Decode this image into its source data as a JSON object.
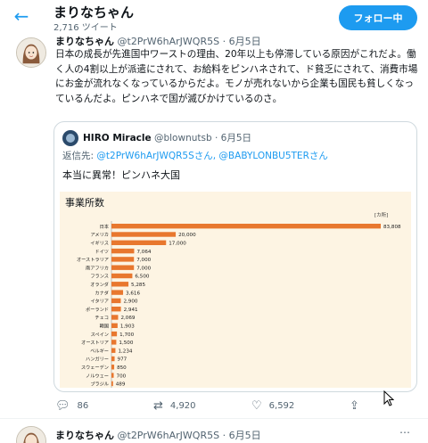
{
  "header": {
    "title": "まりなちゃん",
    "tweet_count": "2,716 ツイート",
    "follow_label": "フォロー中"
  },
  "tweet": {
    "name": "まりなちゃん",
    "handle": "@t2PrW6hArJWQR5S",
    "date": "6月5日",
    "body": "日本の成長が先進国中ワーストの理由、20年以上も停滞している原因がこれだよ。働く人の4割以上が派遣にされて、お給料をピンハネされて、ド貧乏にされて、消費市場にお金が流れなくなっているからだよ。モノが売れないから企業も国民も貧しくなっているんだよ。ピンハネで国が滅びかけているのさ。",
    "quote": {
      "name": "HIRO Miracle",
      "handle": "@blownutsb",
      "date": "6月5日",
      "reply_prefix": "返信先:",
      "reply_mentions": "@t2PrW6hArJWQR5Sさん, @BABYLONBU5TERさん",
      "text": "本当に異常！ピンハネ大国"
    },
    "actions": {
      "replies": "86",
      "retweets": "4,920",
      "likes": "6,592"
    }
  },
  "tweet2": {
    "name": "まりなちゃん",
    "handle": "@t2PrW6hArJWQR5S",
    "date": "6月5日"
  },
  "chart_data": {
    "type": "bar",
    "title": "事業所数",
    "unit": "[カ所]",
    "categories": [
      "日本",
      "アメリカ",
      "イギリス",
      "ドイツ",
      "オーストラリア",
      "南アフリカ",
      "フランス",
      "オランダ",
      "カナダ",
      "イタリア",
      "ポーランド",
      "チェコ",
      "韓国",
      "スペイン",
      "オーストリア",
      "ベルギー",
      "ハンガリー",
      "スウェーデン",
      "ノルウェー",
      "ブラジル"
    ],
    "values": [
      83808,
      20000,
      17000,
      7064,
      7000,
      7000,
      6500,
      5285,
      3616,
      2900,
      2941,
      2069,
      1903,
      1700,
      1500,
      1234,
      977,
      850,
      700,
      489
    ],
    "labels": [
      "83,808",
      "20,000",
      "17,000",
      "7,064",
      "7,000",
      "7,000",
      "6,500",
      "5,285",
      "3,616",
      "2,900",
      "2,941",
      "2,069",
      "1,903",
      "1,700",
      "1,500",
      "1,234",
      "977",
      "850",
      "700",
      "489"
    ],
    "xlim": [
      0,
      83808
    ],
    "bar_color": "#e8772e"
  },
  "colors": {
    "accent": "#1d9bf0",
    "chart_background": "#fdf4e3"
  },
  "icons": {
    "back": "back-arrow-icon",
    "reply": "reply-icon",
    "retweet": "retweet-icon",
    "like": "heart-icon",
    "share": "share-icon",
    "more": "more-icon"
  }
}
